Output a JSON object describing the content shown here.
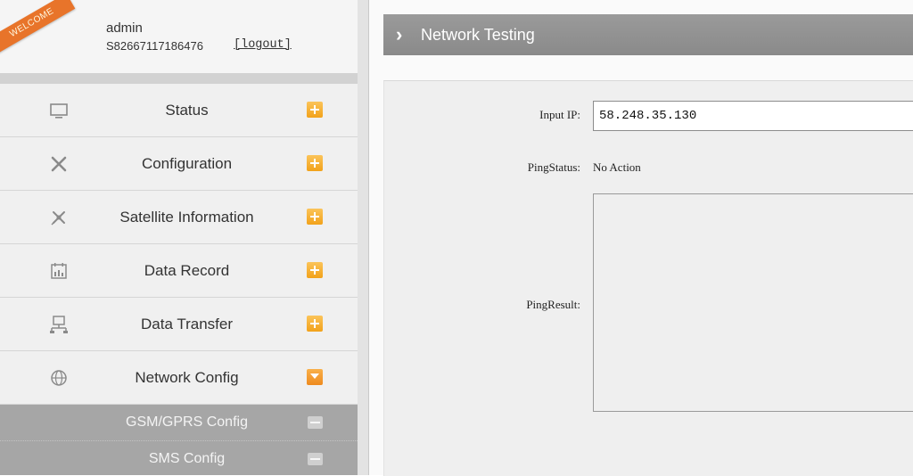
{
  "user": {
    "welcome": "WELCOME",
    "name": "admin",
    "serial": "S82667117186476",
    "logout": "[logout]"
  },
  "menu": [
    {
      "label": "Status",
      "icon": "monitor-icon",
      "state": "collapsed"
    },
    {
      "label": "Configuration",
      "icon": "tools-icon",
      "state": "collapsed"
    },
    {
      "label": "Satellite Information",
      "icon": "satellite-icon",
      "state": "collapsed"
    },
    {
      "label": "Data Record",
      "icon": "calendar-chart-icon",
      "state": "collapsed"
    },
    {
      "label": "Data Transfer",
      "icon": "network-icon",
      "state": "collapsed"
    },
    {
      "label": "Network Config",
      "icon": "globe-icon",
      "state": "expanded"
    }
  ],
  "submenu": [
    {
      "label": "GSM/GPRS Config"
    },
    {
      "label": "SMS Config"
    }
  ],
  "page": {
    "title": "Network Testing"
  },
  "form": {
    "ip_label": "Input IP:",
    "ip_value": "58.248.35.130",
    "status_label": "PingStatus:",
    "status_value": "No Action",
    "result_label": "PingResult:",
    "result_value": ""
  },
  "colors": {
    "accent_orange": "#f2a21a",
    "title_bar": "#909090",
    "submenu_bg": "#a6a6a6"
  }
}
